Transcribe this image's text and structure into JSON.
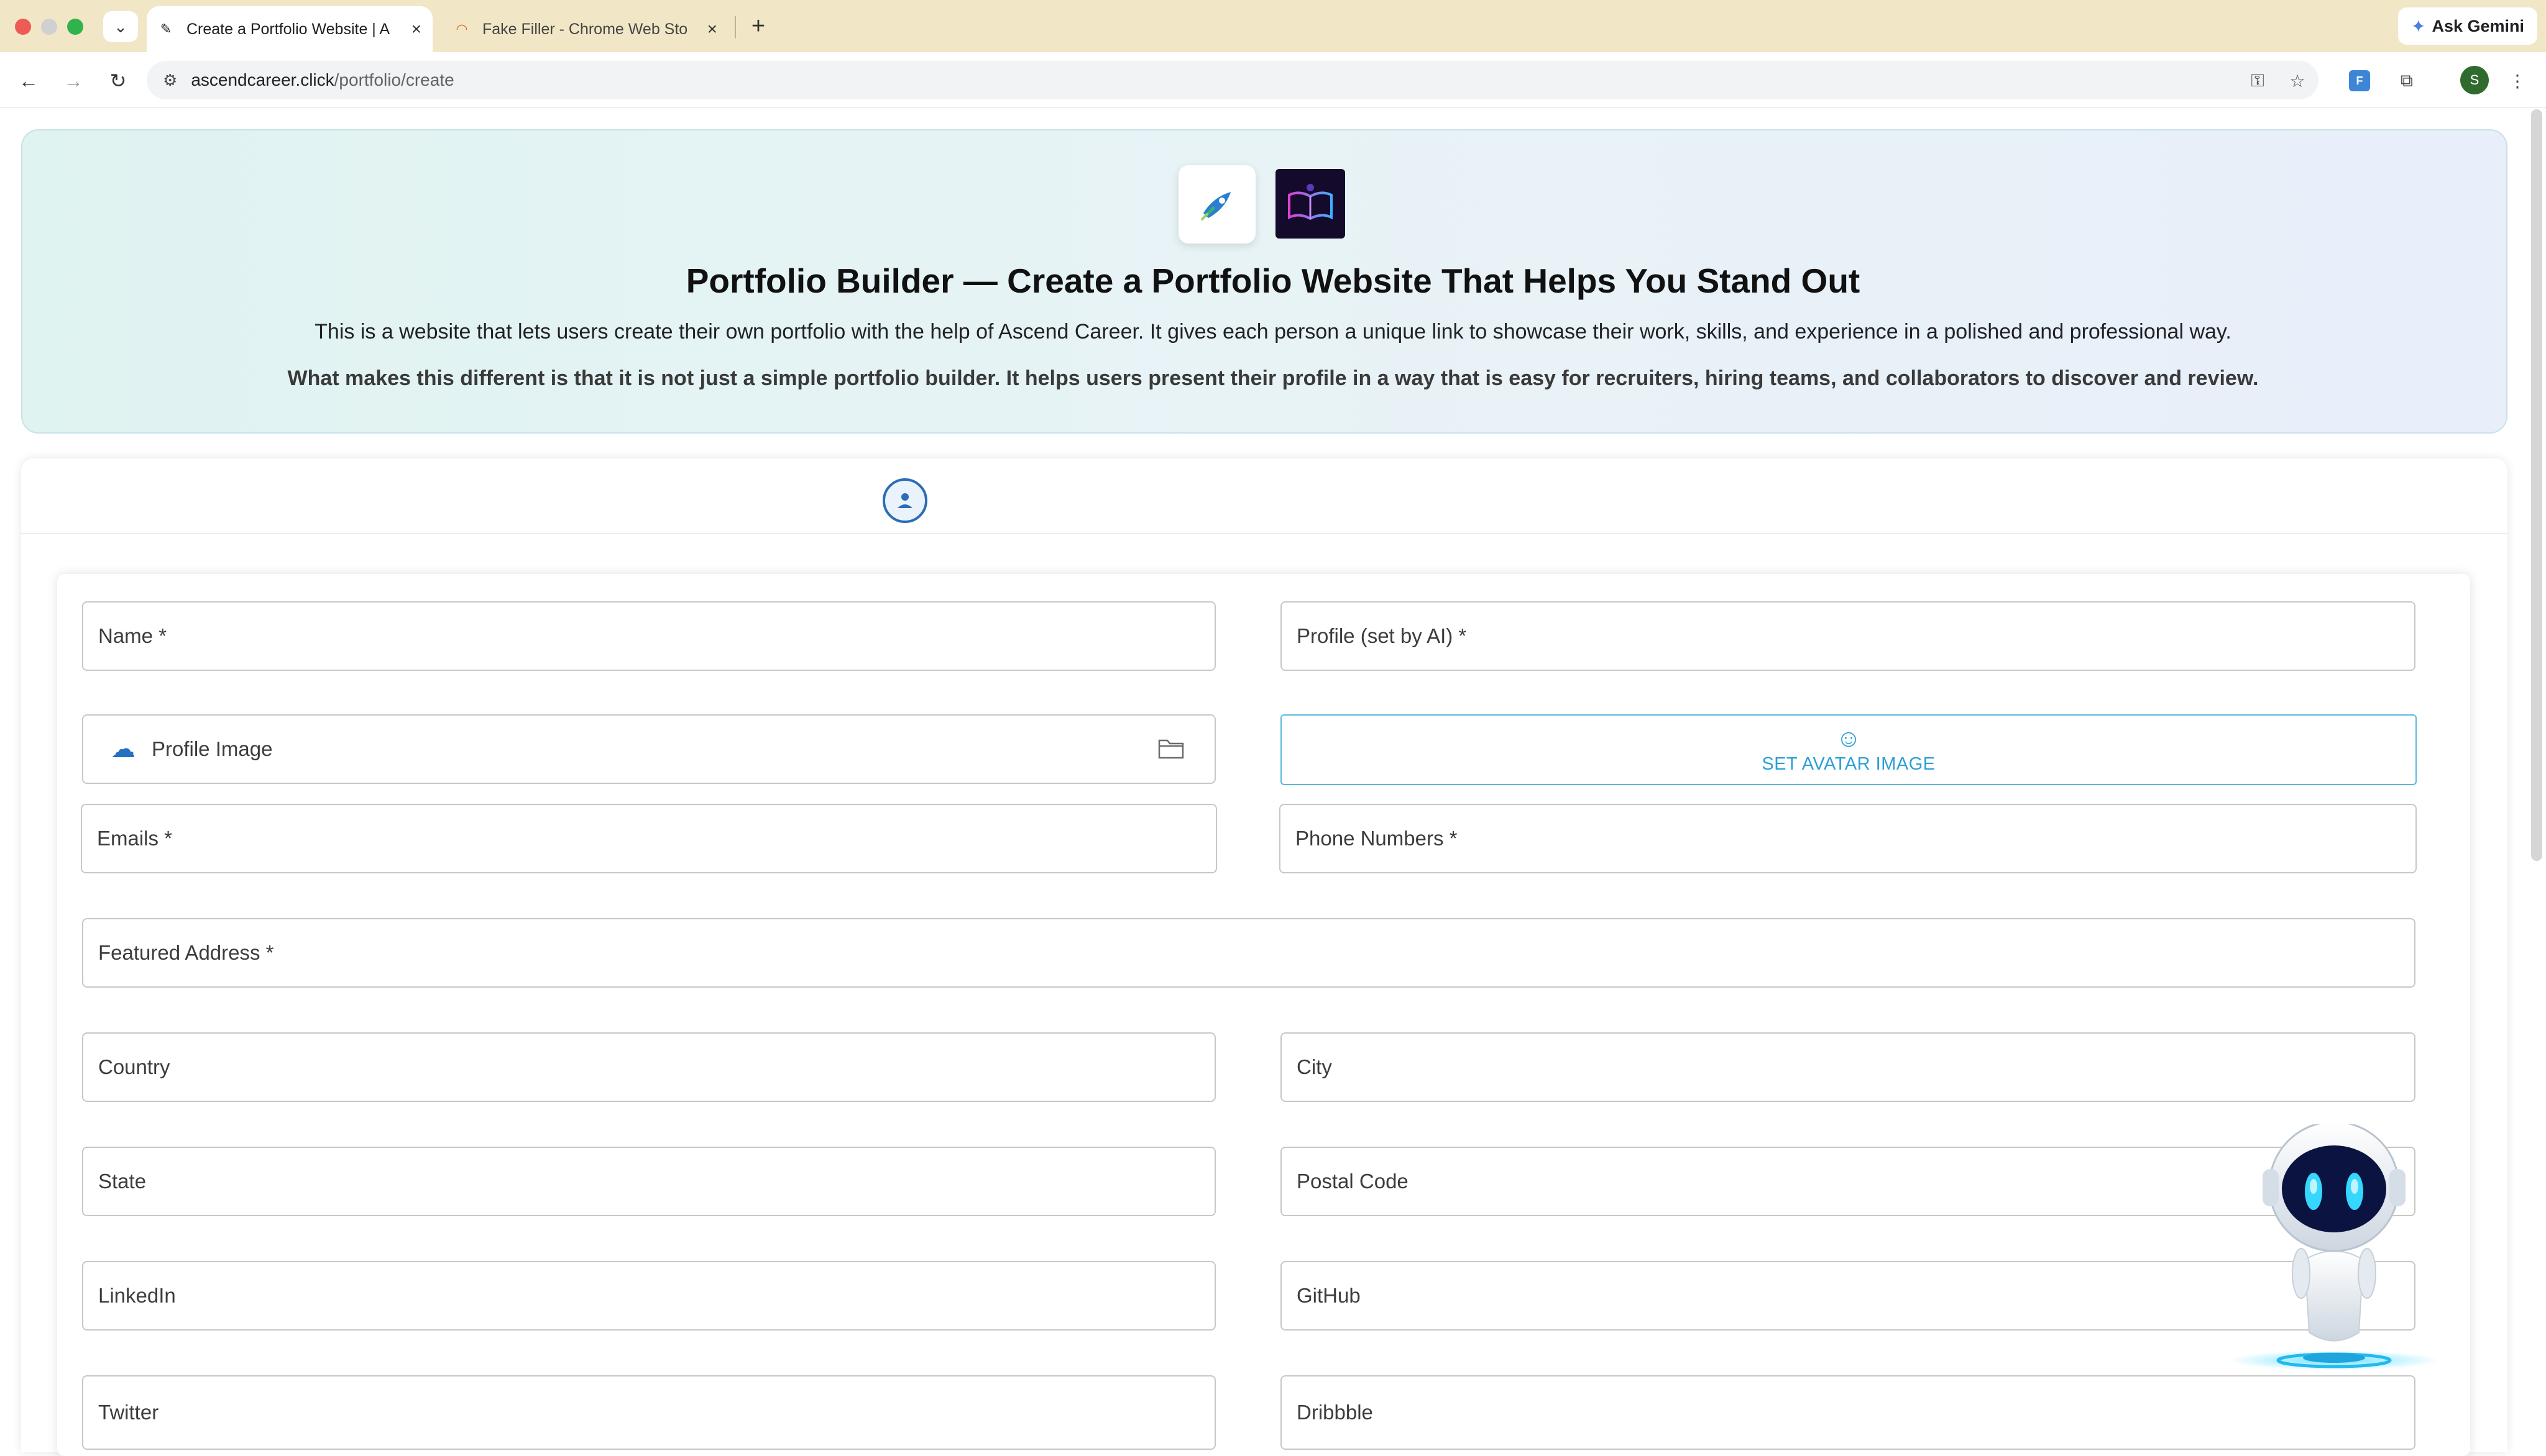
{
  "browser": {
    "tabs": [
      {
        "title": "Create a Portfolio Website | A",
        "active": true
      },
      {
        "title": "Fake Filler - Chrome Web Sto",
        "active": false
      }
    ],
    "new_tab": "+",
    "gemini_label": "Ask Gemini",
    "url_host": "ascendcareer.click",
    "url_path": "/portfolio/create",
    "profile_initial": "S",
    "extension_badge": "F"
  },
  "hero": {
    "title": "Portfolio Builder — Create a Portfolio Website That Helps You Stand Out",
    "description": "This is a website that lets users create their own portfolio with the help of Ascend Career. It gives each person a unique link to showcase their work, skills, and experience in a polished and professional way.",
    "description2": "What makes this different is that it is not just a simple portfolio builder. It helps users present their profile in a way that is easy for recruiters, hiring teams, and collaborators to discover and review."
  },
  "form": {
    "name": "Name *",
    "profile_ai": "Profile (set by AI) *",
    "profile_image": "Profile Image",
    "set_avatar": "SET AVATAR IMAGE",
    "emails": "Emails *",
    "phones": "Phone Numbers *",
    "featured_address": "Featured Address *",
    "country": "Country",
    "city": "City",
    "state": "State",
    "postal_code": "Postal Code",
    "linkedin": "LinkedIn",
    "github": "GitHub",
    "twitter": "Twitter",
    "dribbble": "Dribbble"
  },
  "colors": {
    "accent": "#2a9fd6",
    "step_blue": "#2a6db5",
    "tabbar": "#f1e7c6"
  }
}
